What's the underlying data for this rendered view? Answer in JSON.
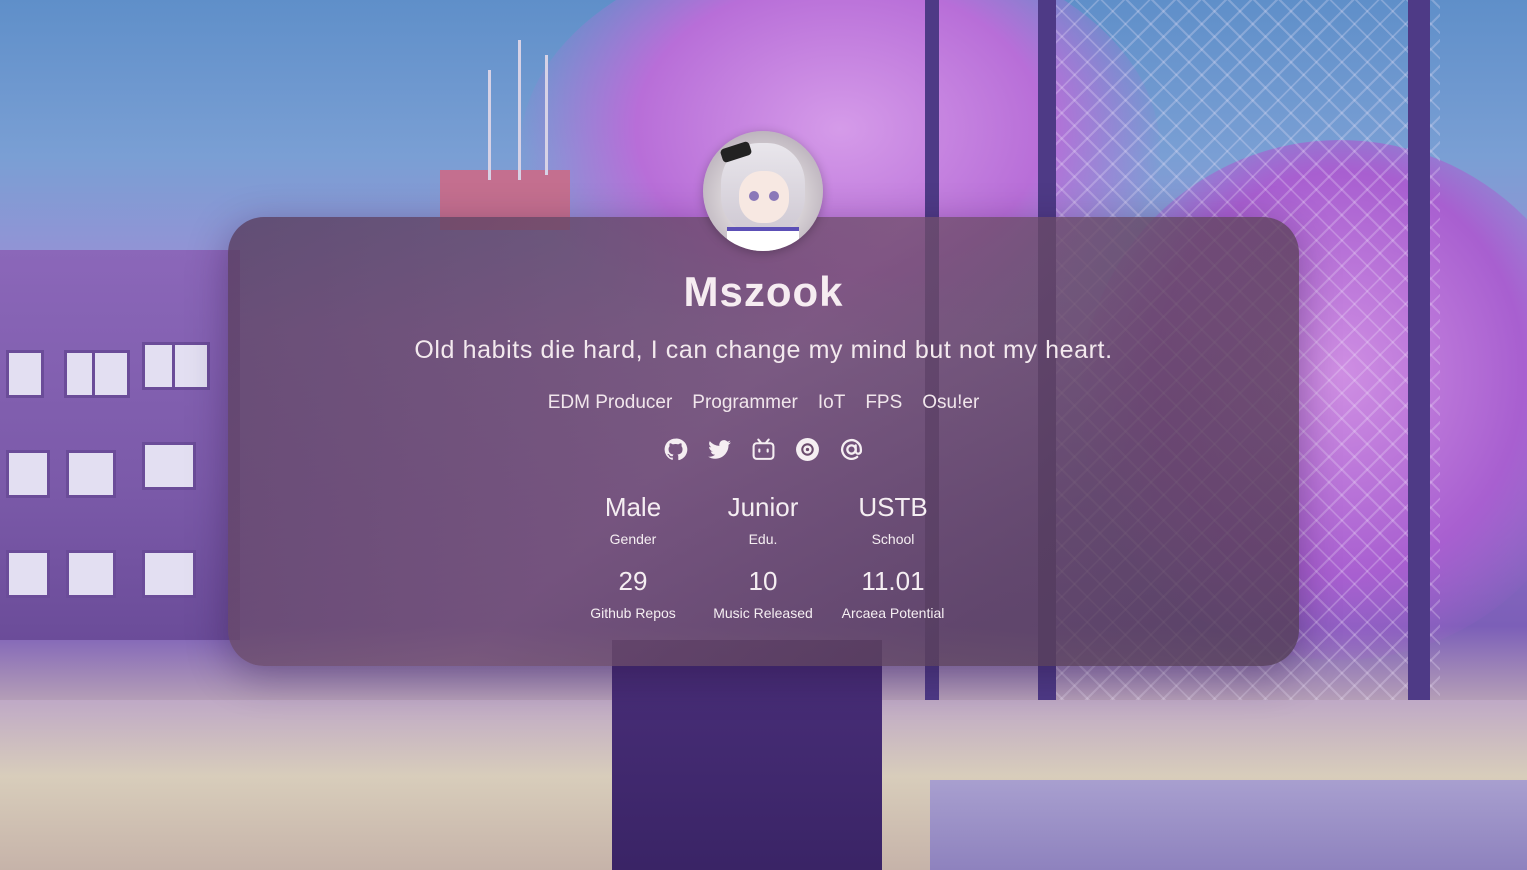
{
  "profile": {
    "name": "Mszook",
    "motto": "Old habits die hard, I can change my mind but not my heart.",
    "tags": [
      "EDM Producer",
      "Programmer",
      "IoT",
      "FPS",
      "Osu!er"
    ],
    "social_icons": [
      "github-icon",
      "twitter-icon",
      "bilibili-icon",
      "netease-music-icon",
      "email-icon"
    ]
  },
  "stats": [
    {
      "value": "Male",
      "label": "Gender"
    },
    {
      "value": "Junior",
      "label": "Edu."
    },
    {
      "value": "USTB",
      "label": "School"
    },
    {
      "value": "29",
      "label": "Github Repos"
    },
    {
      "value": "10",
      "label": "Music Released"
    },
    {
      "value": "11.01",
      "label": "Arcaea Potential"
    }
  ],
  "colors": {
    "card": "#6a4a6c",
    "text": "#f5eef2",
    "accent_tree": "#c27fe0"
  }
}
